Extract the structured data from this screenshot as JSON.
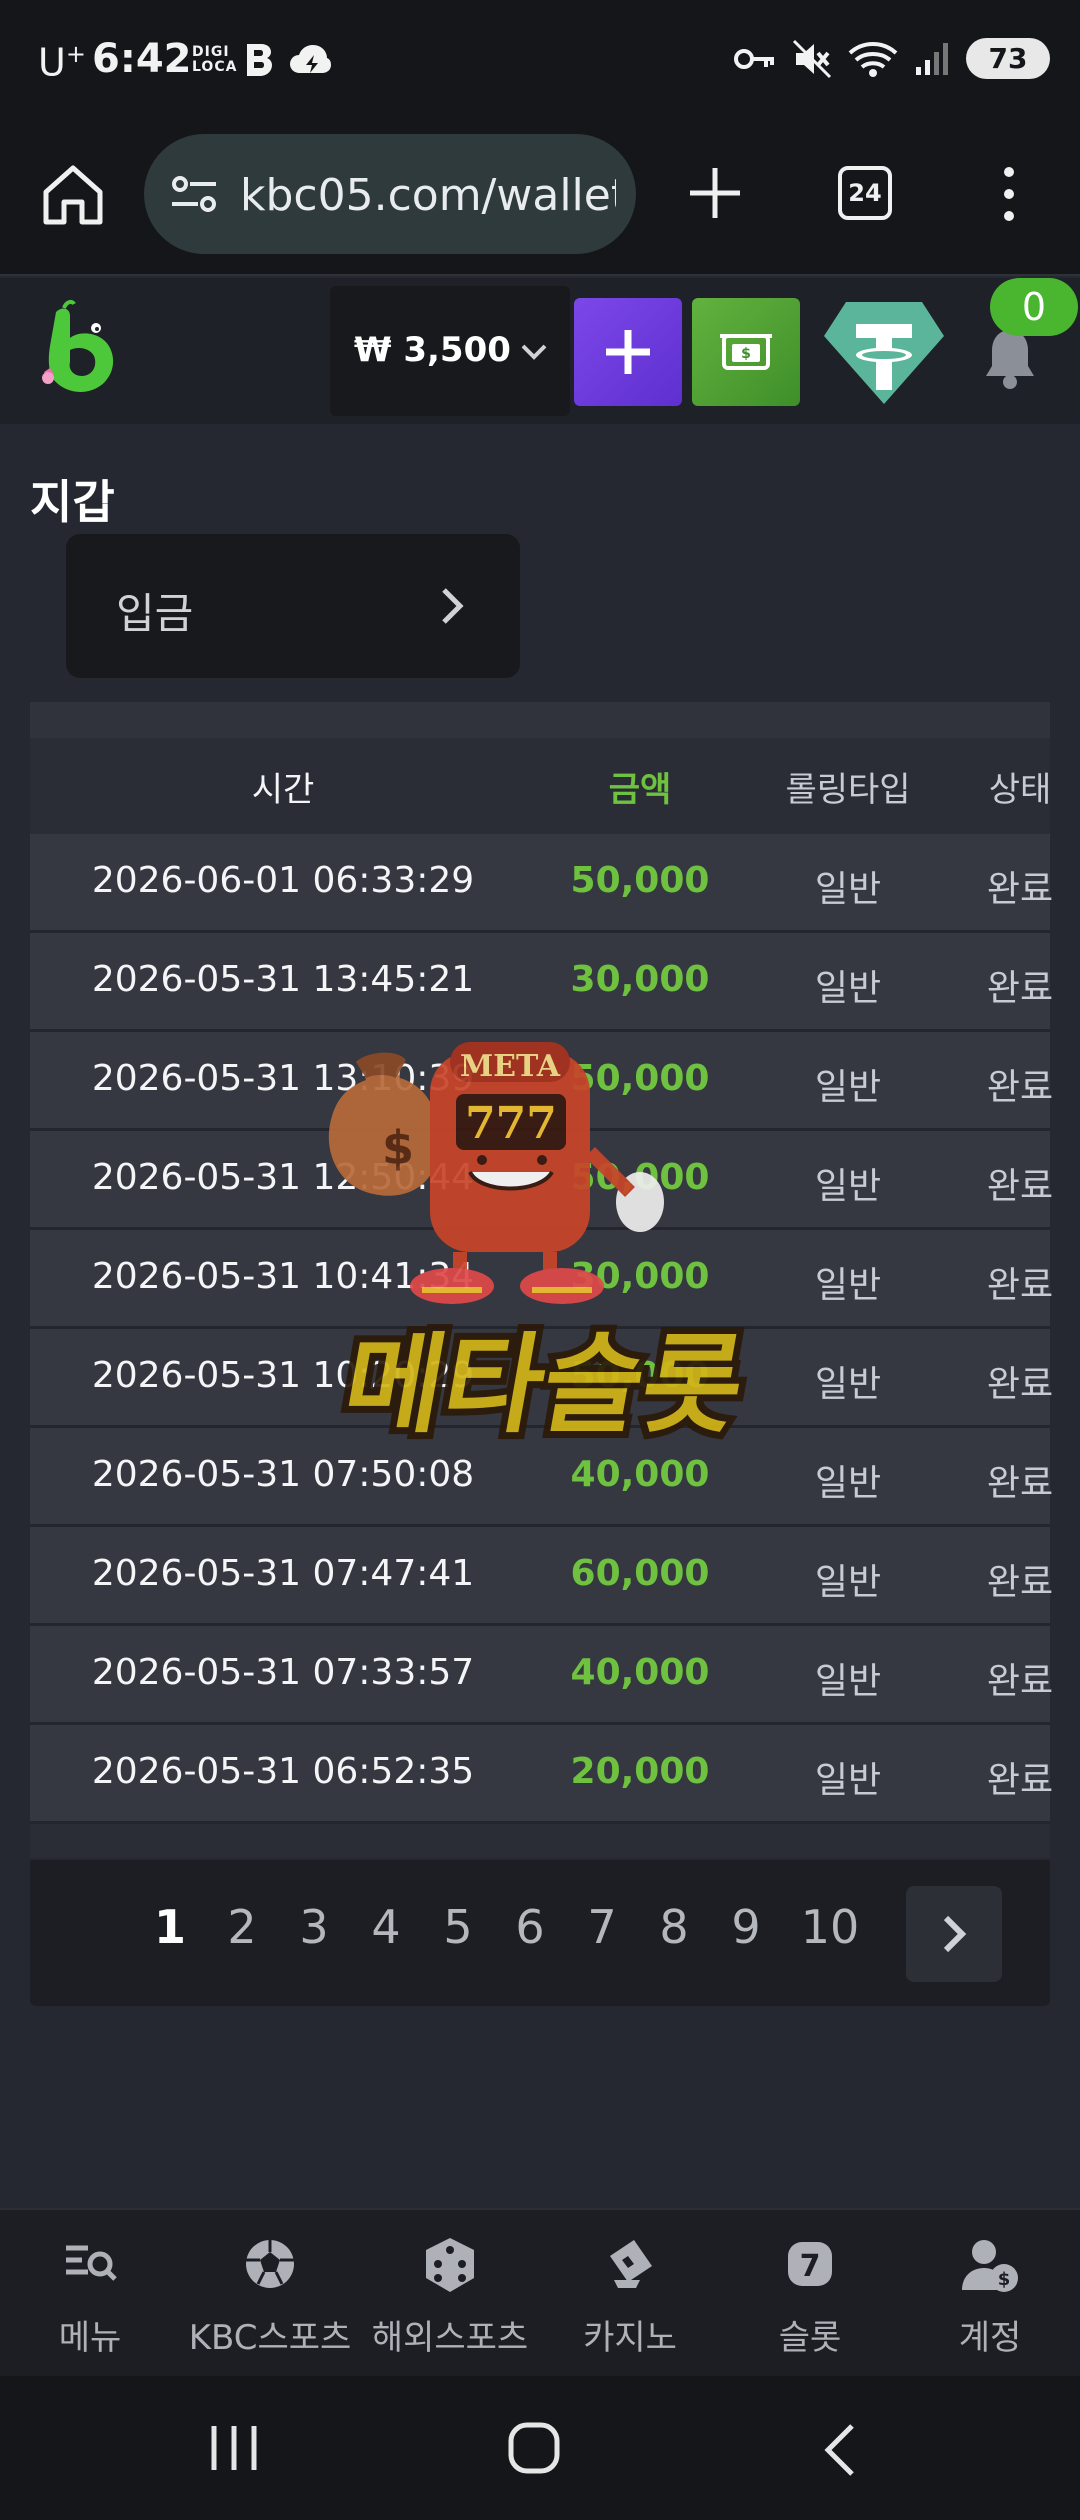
{
  "status_bar": {
    "carrier": "U",
    "carrier_sup": "+",
    "time": "6:42",
    "app_badge": "DIGI LOCA",
    "battery": "73"
  },
  "browser": {
    "url": "kbc05.com/wallet",
    "tab_count": "24"
  },
  "header": {
    "balance": "₩ 3,500",
    "notification_count": "0"
  },
  "wallet": {
    "title": "지갑",
    "selected_tab": "입금",
    "columns": {
      "time": "시간",
      "amount": "금액",
      "rolling_type": "롤링타입",
      "status": "상태"
    },
    "rows": [
      {
        "time": "2026-06-01 06:33:29",
        "amount": "50,000",
        "type": "일반",
        "status": "완료"
      },
      {
        "time": "2026-05-31 13:45:21",
        "amount": "30,000",
        "type": "일반",
        "status": "완료"
      },
      {
        "time": "2026-05-31 13:10:39",
        "amount": "50,000",
        "type": "일반",
        "status": "완료"
      },
      {
        "time": "2026-05-31 12:50:44",
        "amount": "50,000",
        "type": "일반",
        "status": "완료"
      },
      {
        "time": "2026-05-31 10:41:34",
        "amount": "30,000",
        "type": "일반",
        "status": "완료"
      },
      {
        "time": "2026-05-31 10:20:29",
        "amount": "50,000",
        "type": "일반",
        "status": "완료"
      },
      {
        "time": "2026-05-31 07:50:08",
        "amount": "40,000",
        "type": "일반",
        "status": "완료"
      },
      {
        "time": "2026-05-31 07:47:41",
        "amount": "60,000",
        "type": "일반",
        "status": "완료"
      },
      {
        "time": "2026-05-31 07:33:57",
        "amount": "40,000",
        "type": "일반",
        "status": "완료"
      },
      {
        "time": "2026-05-31 06:52:35",
        "amount": "20,000",
        "type": "일반",
        "status": "완료"
      }
    ],
    "pages": [
      "1",
      "2",
      "3",
      "4",
      "5",
      "6",
      "7",
      "8",
      "9",
      "10"
    ],
    "current_page": "1"
  },
  "watermark": {
    "machine_text": "META",
    "reels_text": "777",
    "brand_text": "메타슬롯"
  },
  "bottom_nav": [
    {
      "label": "메뉴",
      "icon": "menu-search-icon"
    },
    {
      "label": "KBC스포츠",
      "icon": "soccer-ball-icon"
    },
    {
      "label": "해외스포츠",
      "icon": "dice-icon"
    },
    {
      "label": "카지노",
      "icon": "cards-icon"
    },
    {
      "label": "슬롯",
      "icon": "slot-seven-icon"
    },
    {
      "label": "계정",
      "icon": "account-icon"
    }
  ],
  "colors": {
    "background": "#252830",
    "amount_green": "#6fc23f",
    "deposit_purple": "#7c47e8",
    "cashier_green": "#4ab52e",
    "tether_teal": "#5bb59a"
  }
}
